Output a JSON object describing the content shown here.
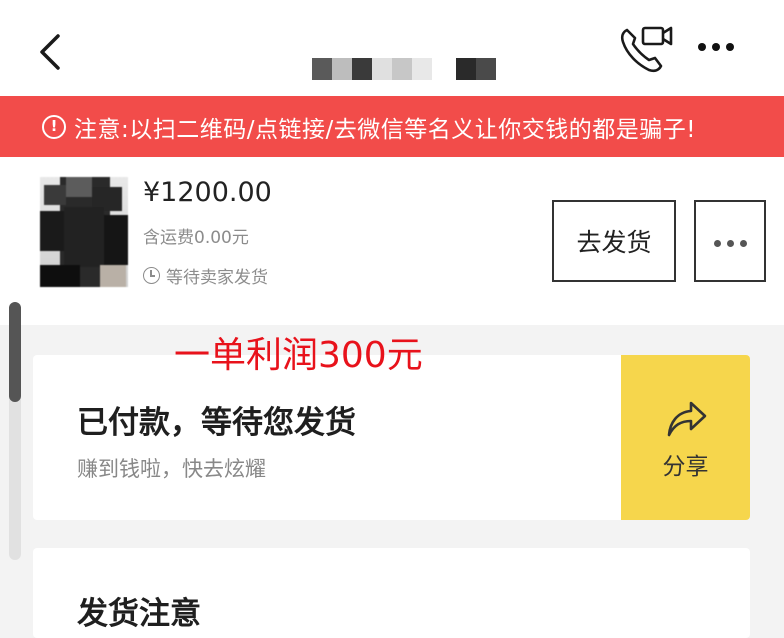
{
  "header": {
    "title_masked": "",
    "back_icon": "chevron-left-icon",
    "call_icon": "video-call-icon",
    "more_icon": "more-dots-icon"
  },
  "warning": {
    "icon": "info-icon",
    "icon_glyph": "!",
    "text": "注意:以扫二维码/点链接/去微信等名义让你交钱的都是骗子!"
  },
  "order": {
    "price": "¥1200.00",
    "shipping_fee": "含运费0.00元",
    "status": "等待卖家发货",
    "ship_button_label": "去发货"
  },
  "overlay_annotation": "一单利润300元",
  "status_card": {
    "title": "已付款，等待您发货",
    "subtitle": "赚到钱啦，快去炫耀",
    "share_label": "分享"
  },
  "notice_card": {
    "title": "发货注意"
  },
  "colors": {
    "warning_bg": "#f24c4a",
    "share_bg": "#f6d64c",
    "overlay_text": "#e8121b"
  }
}
